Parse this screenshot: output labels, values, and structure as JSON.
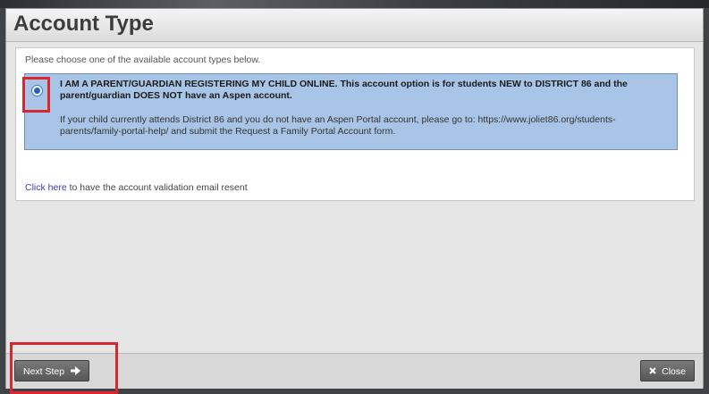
{
  "dialog": {
    "title": "Account Type",
    "instructions": "Please choose one of the available account types below.",
    "option": {
      "selected": true,
      "title": "I AM A PARENT/GUARDIAN REGISTERING MY CHILD ONLINE. This account option is for students NEW to DISTRICT 86 and the parent/guardian DOES NOT have an Aspen account.",
      "description": "If your child currently attends District 86 and you do not have an Aspen Portal account, please go to: https://www.joliet86.org/students-parents/family-portal-help/ and submit the Request a Family Portal Account form."
    },
    "resend": {
      "link_text": "Click here",
      "text": " to have the account validation email resent"
    },
    "buttons": {
      "next_label": "Next Step",
      "next_icon": "arrow-right-icon",
      "close_label": "Close",
      "close_icon": "x-icon"
    }
  },
  "colors": {
    "highlight": "#d9262f",
    "option_background": "#a8c4e6",
    "link": "#3a3fa8"
  }
}
